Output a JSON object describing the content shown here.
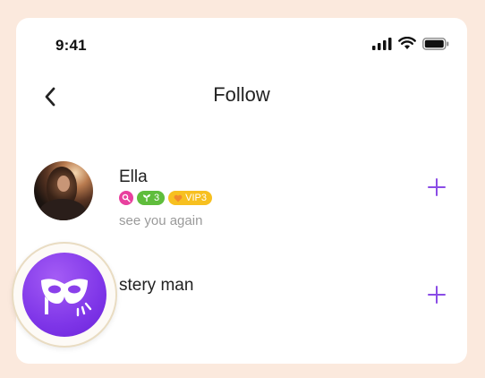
{
  "status_bar": {
    "time": "9:41",
    "icons": [
      "signal-icon",
      "wifi-icon",
      "battery-icon"
    ]
  },
  "header": {
    "title": "Follow",
    "back_icon": "chevron-left-icon"
  },
  "follow_list": [
    {
      "name": "Ella",
      "badges": {
        "key_icon": "key-icon",
        "level": "3",
        "level_icon": "sprout-icon",
        "vip": "VIP3",
        "vip_icon": "heart-icon"
      },
      "signature": "see you again",
      "action_icon": "plus-icon"
    },
    {
      "name": "stery man",
      "action_icon": "plus-icon"
    }
  ],
  "fab": {
    "icon": "mask-icon"
  },
  "colors": {
    "accent": "#8a4ce6",
    "background": "#fbe9dd",
    "badge_key": "#e8409e",
    "badge_level": "#5fbd3c",
    "badge_vip": "#f7c020"
  }
}
